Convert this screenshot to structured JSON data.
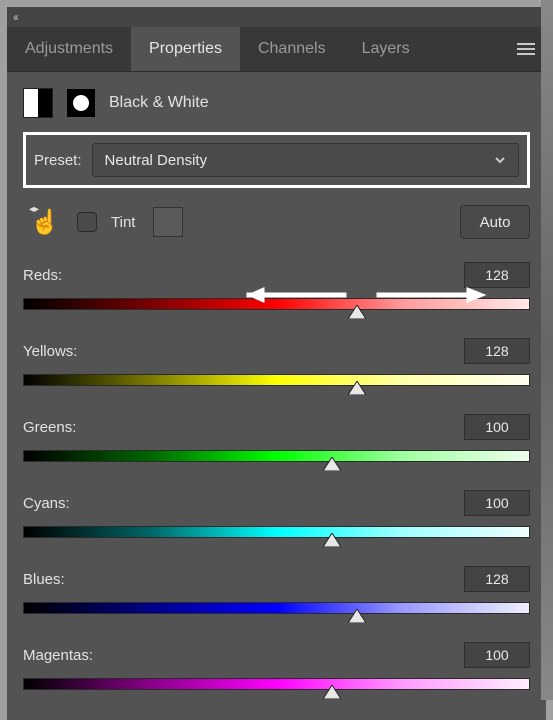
{
  "tabs": [
    "Adjustments",
    "Properties",
    "Channels",
    "Layers"
  ],
  "header": {
    "title": "Black & White"
  },
  "preset": {
    "label": "Preset:",
    "value": "Neutral Density"
  },
  "tint": {
    "label": "Tint",
    "checked": false,
    "auto": "Auto"
  },
  "sliders": [
    {
      "key": "reds",
      "label": "Reds:",
      "value": 128
    },
    {
      "key": "yellows",
      "label": "Yellows:",
      "value": 128
    },
    {
      "key": "greens",
      "label": "Greens:",
      "value": 100
    },
    {
      "key": "cyans",
      "label": "Cyans:",
      "value": 100
    },
    {
      "key": "blues",
      "label": "Blues:",
      "value": 128
    },
    {
      "key": "magentas",
      "label": "Magentas:",
      "value": 100
    }
  ],
  "slider_range": {
    "min": -200,
    "max": 300
  }
}
